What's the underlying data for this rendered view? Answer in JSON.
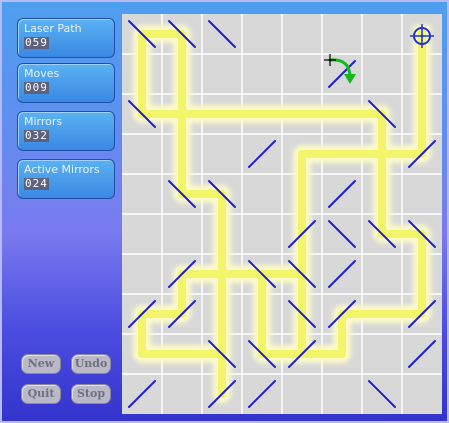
{
  "stats": [
    {
      "label": "Laser Path",
      "value": "059"
    },
    {
      "label": "Moves",
      "value": "009"
    },
    {
      "label": "Mirrors",
      "value": "032"
    },
    {
      "label": "Active Mirrors",
      "value": "024"
    }
  ],
  "buttons": {
    "new": "New",
    "undo": "Undo",
    "quit": "Quit",
    "stop": "Stop"
  },
  "colors": {
    "mirror": "#2020d0",
    "laser": "#f2f56a",
    "laser_glow": "#fdfcc8",
    "grid_line": "#ffffff",
    "board": "#d8d8d8",
    "target": "#2233cc",
    "move_arrow": "#16b81c"
  },
  "grid": {
    "cols": 8,
    "rows": 10
  },
  "mirrors": [
    {
      "col": 0,
      "row": 0,
      "type": "\\"
    },
    {
      "col": 1,
      "row": 0,
      "type": "\\"
    },
    {
      "col": 2,
      "row": 0,
      "type": "\\"
    },
    {
      "col": 5,
      "row": 1,
      "type": "/"
    },
    {
      "col": 0,
      "row": 2,
      "type": "\\"
    },
    {
      "col": 6,
      "row": 2,
      "type": "\\"
    },
    {
      "col": 3,
      "row": 3,
      "type": "/"
    },
    {
      "col": 7,
      "row": 3,
      "type": "/"
    },
    {
      "col": 1,
      "row": 4,
      "type": "\\"
    },
    {
      "col": 2,
      "row": 4,
      "type": "\\"
    },
    {
      "col": 5,
      "row": 4,
      "type": "/"
    },
    {
      "col": 4,
      "row": 5,
      "type": "/"
    },
    {
      "col": 5,
      "row": 5,
      "type": "\\"
    },
    {
      "col": 6,
      "row": 5,
      "type": "\\"
    },
    {
      "col": 7,
      "row": 5,
      "type": "\\"
    },
    {
      "col": 1,
      "row": 6,
      "type": "/"
    },
    {
      "col": 3,
      "row": 6,
      "type": "\\"
    },
    {
      "col": 4,
      "row": 6,
      "type": "\\"
    },
    {
      "col": 5,
      "row": 6,
      "type": "/"
    },
    {
      "col": 0,
      "row": 7,
      "type": "/"
    },
    {
      "col": 1,
      "row": 7,
      "type": "/"
    },
    {
      "col": 4,
      "row": 7,
      "type": "\\"
    },
    {
      "col": 5,
      "row": 7,
      "type": "/"
    },
    {
      "col": 7,
      "row": 7,
      "type": "/"
    },
    {
      "col": 2,
      "row": 8,
      "type": "\\"
    },
    {
      "col": 3,
      "row": 8,
      "type": "\\"
    },
    {
      "col": 4,
      "row": 8,
      "type": "/"
    },
    {
      "col": 7,
      "row": 8,
      "type": "/"
    },
    {
      "col": 0,
      "row": 9,
      "type": "/"
    },
    {
      "col": 2,
      "row": 9,
      "type": "/"
    },
    {
      "col": 3,
      "row": 9,
      "type": "/"
    },
    {
      "col": 6,
      "row": 9,
      "type": "\\"
    }
  ],
  "laser_path": [
    [
      7,
      0
    ],
    [
      7,
      3
    ],
    [
      6,
      3
    ],
    [
      6,
      5
    ],
    [
      7,
      5
    ],
    [
      7,
      7
    ],
    [
      5,
      7
    ],
    [
      5,
      8
    ],
    [
      3,
      8
    ],
    [
      3,
      6
    ],
    [
      2,
      6
    ],
    [
      2,
      9
    ],
    [
      2,
      8
    ],
    [
      0,
      8
    ],
    [
      0,
      7
    ],
    [
      1,
      7
    ],
    [
      1,
      6
    ],
    [
      4,
      6
    ],
    [
      4,
      8
    ],
    [
      4,
      3
    ],
    [
      6,
      3
    ],
    [
      6,
      2
    ],
    [
      1,
      2
    ],
    [
      1,
      0
    ],
    [
      0,
      0
    ],
    [
      0,
      2
    ],
    [
      1,
      2
    ],
    [
      1,
      4
    ],
    [
      2,
      4
    ],
    [
      2,
      6
    ]
  ],
  "target": {
    "col": 7,
    "row": 0
  },
  "move_indicator": {
    "col": 5,
    "row": 1
  }
}
